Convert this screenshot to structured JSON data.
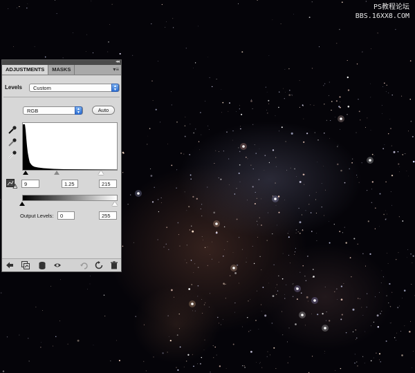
{
  "watermark": {
    "line1": "PS教程论坛",
    "line2": "BBS.16XX8.COM"
  },
  "panel": {
    "tabs": [
      {
        "label": "ADJUSTMENTS",
        "active": true
      },
      {
        "label": "MASKS",
        "active": false
      }
    ],
    "collapse_icon": "double-chevron-icon",
    "menu_icon": "panel-menu-icon",
    "levels_label": "Levels",
    "preset_value": "Custom",
    "channel_value": "RGB",
    "auto_label": "Auto",
    "eyedroppers": [
      "black-eyedropper-icon",
      "gray-eyedropper-icon",
      "white-eyedropper-icon"
    ],
    "input_levels": {
      "black": "9",
      "gamma": "1.25",
      "white": "215"
    },
    "output_label": "Output Levels:",
    "output_levels": {
      "black": "0",
      "white": "255"
    },
    "footer_icons": [
      "back-arrow-icon",
      "clip-layer-icon",
      "layer-mask-icon",
      "eye-icon",
      "view-previous-icon",
      "reset-icon",
      "trash-icon"
    ]
  },
  "colors": {
    "panel_bg": "#d7d7d7",
    "select_accent": "#2d6fd3",
    "space_bg": "#050409"
  }
}
